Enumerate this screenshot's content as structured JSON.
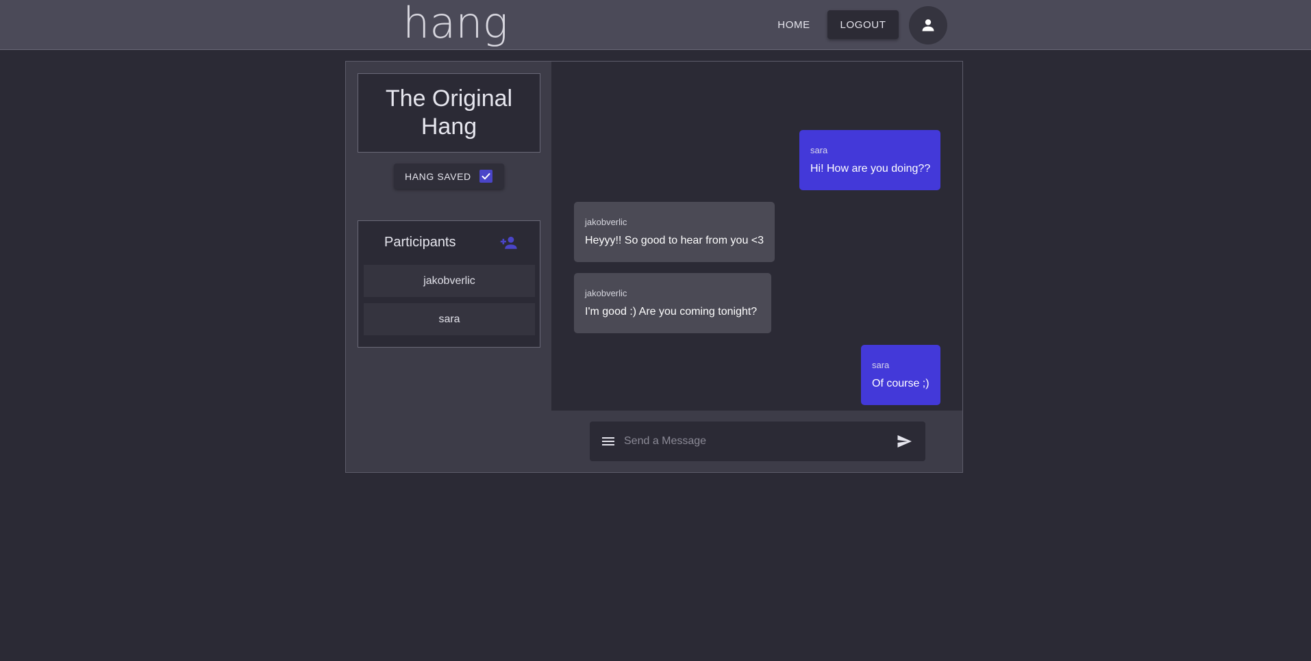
{
  "header": {
    "logo": "hang",
    "nav_home": "HOME",
    "nav_logout": "LOGOUT",
    "avatar_icon": "person-icon"
  },
  "sidebar": {
    "hang_title": "The Original Hang",
    "hang_saved_label": "HANG SAVED",
    "hang_saved_checked": true,
    "participants_title": "Participants",
    "add_participant_icon": "person-add-icon",
    "participants": [
      "jakobverlic",
      "sara"
    ]
  },
  "chat": {
    "messages": [
      {
        "author": "sara",
        "text": "Hi! How are you doing??",
        "mine": true
      },
      {
        "author": "jakobverlic",
        "text": "Heyyy!! So good to hear from you <3",
        "mine": false
      },
      {
        "author": "jakobverlic",
        "text": "I'm good :) Are you coming tonight?",
        "mine": false
      },
      {
        "author": "sara",
        "text": "Of course ;)",
        "mine": true
      }
    ],
    "composer_placeholder": "Send a Message",
    "composer_value": "",
    "menu_icon": "menu-icon",
    "send_icon": "send-icon"
  },
  "colors": {
    "accent": "#4339d9",
    "topbar": "#4b4a58",
    "background": "#2b2a35",
    "sidebar": "#3d3c48",
    "their_bubble": "#4b4a55"
  }
}
